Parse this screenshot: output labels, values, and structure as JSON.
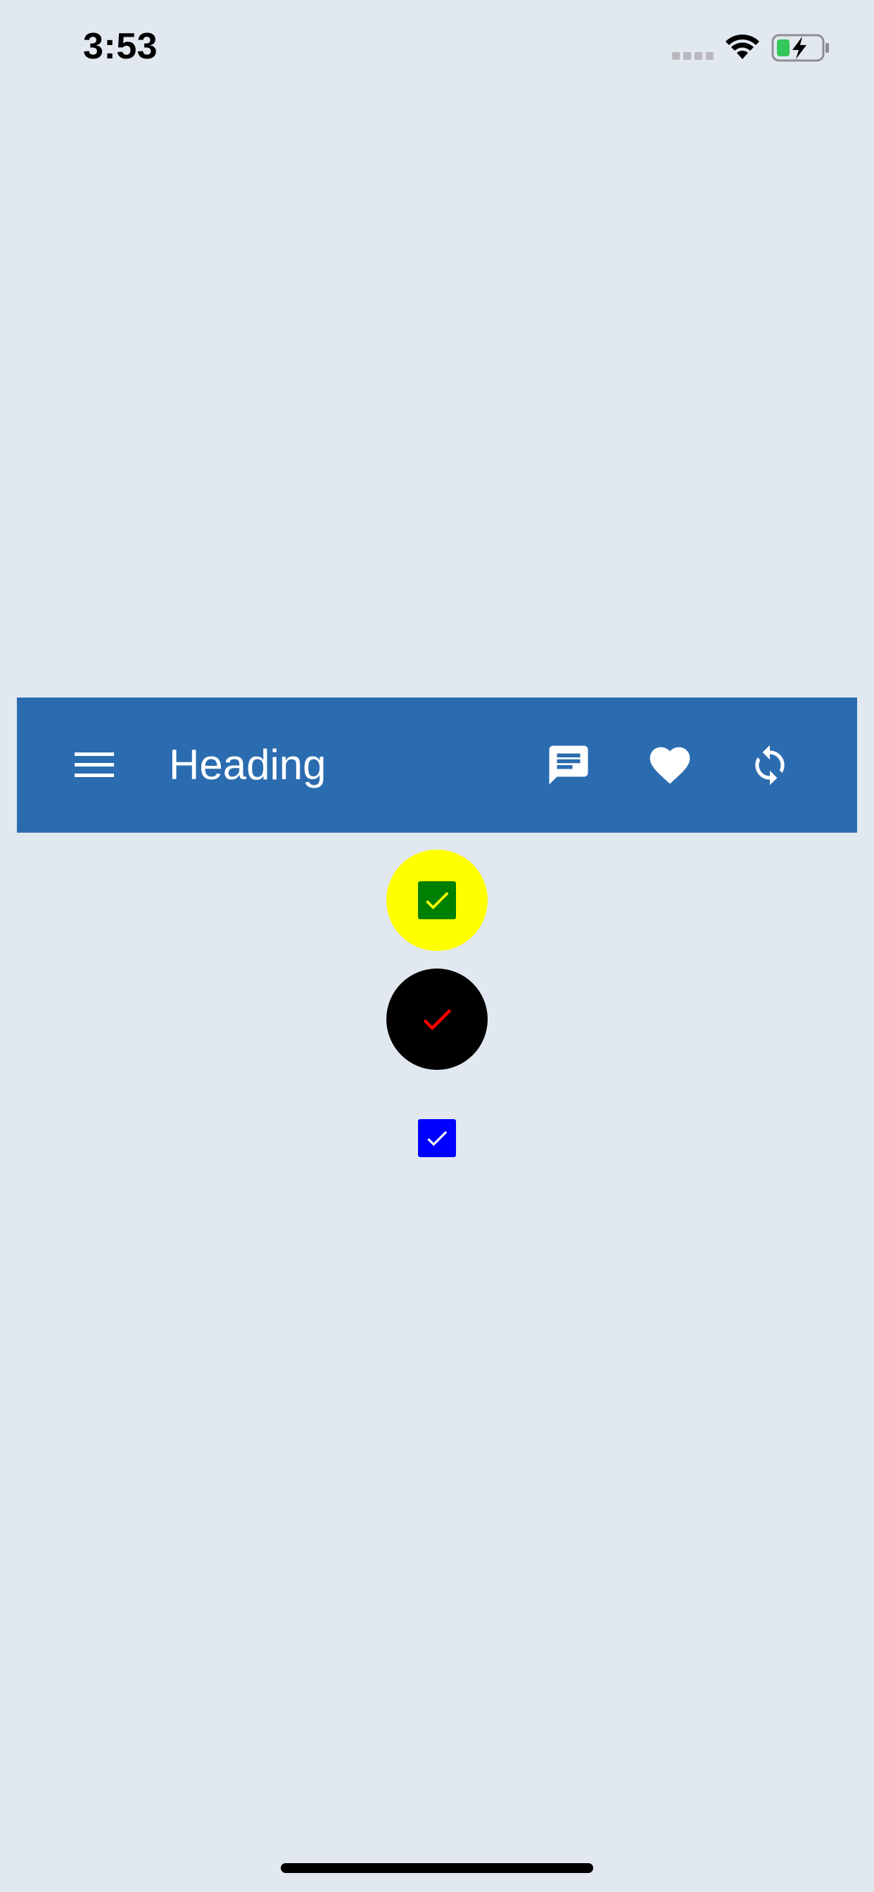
{
  "status_bar": {
    "time": "3:53"
  },
  "app_bar": {
    "title": "Heading",
    "icons": [
      "menu-icon",
      "message-icon",
      "heart-icon",
      "refresh-icon"
    ]
  },
  "checkboxes": [
    {
      "name": "checkbox-yellow",
      "checked": true,
      "background": "#ffff00",
      "box_color": "#008000",
      "check_color": "#ffff00"
    },
    {
      "name": "checkbox-black",
      "checked": true,
      "background": "#000000",
      "box_color": "#000000",
      "check_color": "#ff0000"
    },
    {
      "name": "checkbox-blue",
      "checked": true,
      "background": "none",
      "box_color": "#0000ff",
      "check_color": "#ffffff"
    }
  ],
  "colors": {
    "page_background": "#e2e8f0",
    "app_bar": "#2b6cb0",
    "app_bar_text": "#ffffff",
    "battery_fill": "#34c759"
  }
}
